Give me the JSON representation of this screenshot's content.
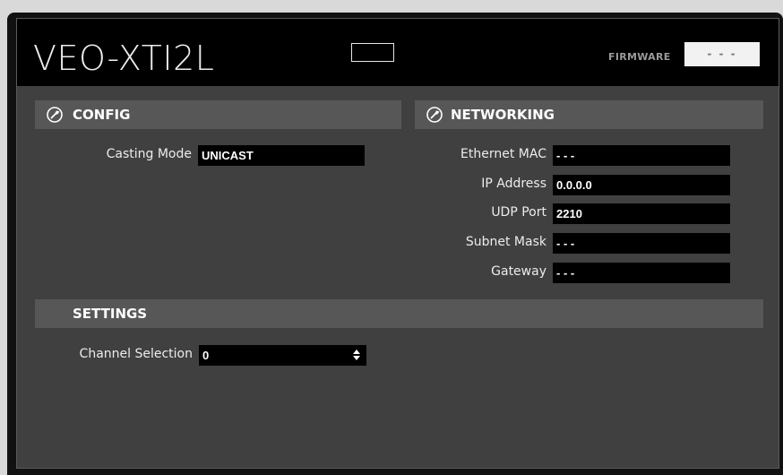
{
  "header": {
    "device_name": "VEO-XTI2L",
    "firmware_label": "FIRMWARE",
    "firmware_value": "- - -"
  },
  "config": {
    "title": "CONFIG",
    "casting_mode_label": "Casting Mode",
    "casting_mode_value": "UNICAST"
  },
  "networking": {
    "title": "NETWORKING",
    "rows": [
      {
        "label": "Ethernet MAC",
        "value": "- - -"
      },
      {
        "label": "IP Address",
        "value": "0.0.0.0"
      },
      {
        "label": "UDP Port",
        "value": "2210"
      },
      {
        "label": "Subnet Mask",
        "value": "- - -"
      },
      {
        "label": "Gateway",
        "value": "- - -"
      }
    ]
  },
  "settings": {
    "title": "SETTINGS",
    "channel_label": "Channel Selection",
    "channel_value": "0"
  },
  "icons": {
    "section_icon": "wrench-icon",
    "select_arrow": "up-down-arrow-icon"
  },
  "colors": {
    "panel_bg": "#404040",
    "header_bg": "#000000",
    "section_bar": "#575757",
    "field_bg": "#000000"
  }
}
